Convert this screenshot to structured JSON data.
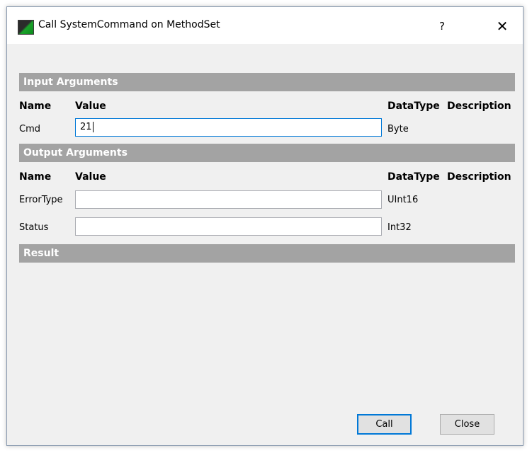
{
  "window": {
    "title": "Call SystemCommand on MethodSet",
    "help_label": "?",
    "close_label": "✕"
  },
  "input_section": {
    "title": "Input Arguments",
    "columns": {
      "name": "Name",
      "value": "Value",
      "datatype": "DataType",
      "description": "Description"
    },
    "rows": [
      {
        "name": "Cmd",
        "value": "21",
        "datatype": "Byte"
      }
    ]
  },
  "output_section": {
    "title": "Output Arguments",
    "columns": {
      "name": "Name",
      "value": "Value",
      "datatype": "DataType",
      "description": "Description"
    },
    "rows": [
      {
        "name": "ErrorType",
        "value": "",
        "datatype": "UInt16"
      },
      {
        "name": "Status",
        "value": "",
        "datatype": "Int32"
      }
    ]
  },
  "result_section": {
    "title": "Result"
  },
  "buttons": {
    "call_label": "Call",
    "close_label": "Close"
  },
  "colors": {
    "section_header_bg": "#a3a3a3",
    "focus_border": "#0078d7"
  }
}
